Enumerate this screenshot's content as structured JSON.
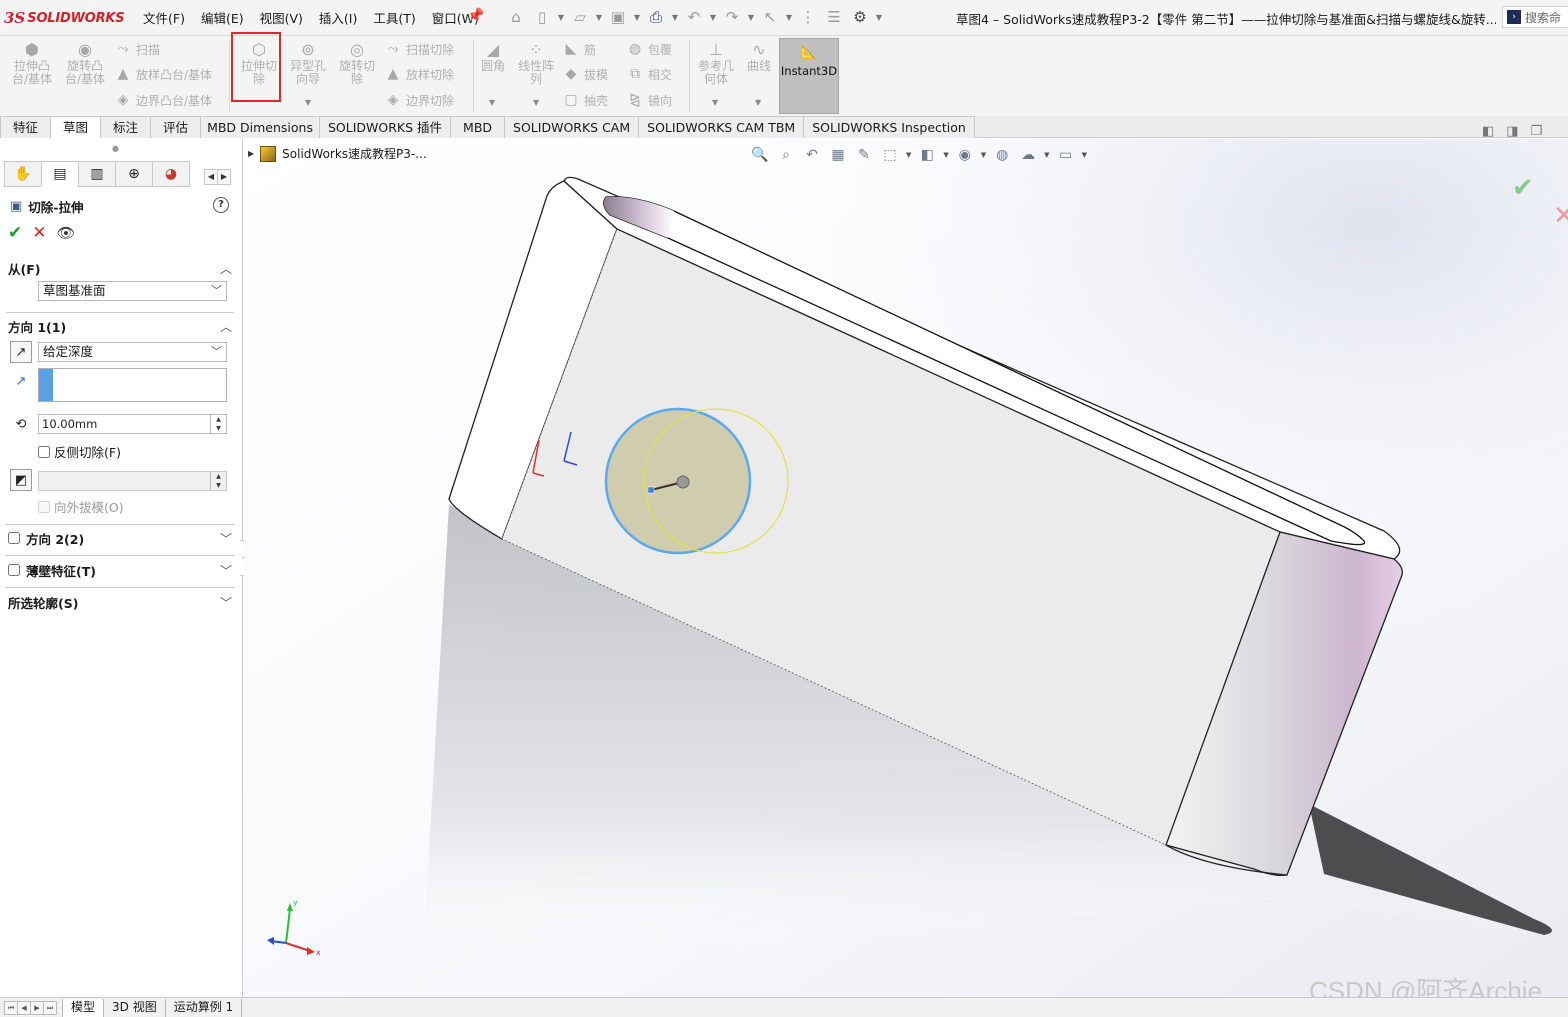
{
  "app": {
    "brand": "SOLIDWORKS",
    "window_title": "草图4 – SolidWorks速成教程P3-2【零件 第二节】——拉伸切除与基准面&扫描与螺旋线&旋转...",
    "search_placeholder": "搜索命"
  },
  "menu": [
    "文件(F)",
    "编辑(E)",
    "视图(V)",
    "插入(I)",
    "工具(T)",
    "窗口(W)"
  ],
  "quick_access": [
    "home-icon",
    "new-file-icon",
    "open-folder-icon",
    "save-icon",
    "print-icon",
    "undo-icon",
    "redo-icon",
    "select-arrow-icon",
    "traffic-light-icon",
    "file-properties-icon",
    "options-gear-icon"
  ],
  "command_manager": {
    "extrude_boss": "拉伸凸\n台/基体",
    "revolve_boss": "旋转凸\n台/基体",
    "sweep": "扫描",
    "loft": "放样凸台/基体",
    "boundary_boss": "边界凸台/基体",
    "extrude_cut": "拉伸切\n除",
    "hole_wizard": "异型孔\n向导",
    "revolve_cut": "旋转切\n除",
    "sweep_cut": "扫描切除",
    "loft_cut": "放样切除",
    "boundary_cut": "边界切除",
    "fillet": "圆角",
    "linear_pattern": "线性阵\n列",
    "rib": "筋",
    "draft": "拔模",
    "shell": "抽壳",
    "wrap": "包覆",
    "intersect": "相交",
    "mirror": "镜向",
    "ref_geometry": "参考几\n何体",
    "curves": "曲线",
    "instant3d": "Instant3D",
    "highlighted_command": "extrude_cut"
  },
  "tabs": {
    "items": [
      "特征",
      "草图",
      "标注",
      "评估",
      "MBD Dimensions",
      "SOLIDWORKS 插件",
      "MBD",
      "SOLIDWORKS CAM",
      "SOLIDWORKS CAM TBM",
      "SOLIDWORKS Inspection"
    ],
    "active": "特征"
  },
  "property_manager": {
    "title": "切除-拉伸",
    "from_section": {
      "label": "从(F)",
      "value": "草图基准面"
    },
    "direction1": {
      "label": "方向 1(1)",
      "end_condition": "给定深度",
      "depth": "10.00mm",
      "flip_side_label": "反侧切除(F)",
      "flip_side_checked": false,
      "draft_outward_label": "向外拔模(O)",
      "draft_outward_checked": false
    },
    "direction2": {
      "label": "方向 2(2)",
      "checked": false
    },
    "thin_feature": {
      "label": "薄壁特征(T)",
      "checked": false
    },
    "selected_contours": {
      "label": "所选轮廓(S)"
    }
  },
  "viewport": {
    "tree_flyout_label": "SolidWorks速成教程P3-...",
    "triad_axes": [
      "y",
      "x"
    ],
    "watermark": "CSDN @阿齐Archie"
  },
  "bottom_tabs": {
    "items": [
      "模型",
      "3D 视图",
      "运动算例 1"
    ],
    "active": "模型"
  },
  "colors": {
    "accent_red": "#e5262a",
    "brand_red": "#d4202a",
    "ok_green": "#1f9a2e",
    "cancel_red": "#d8272e",
    "instant3d_bg": "#bfbfbf",
    "selection_blue": "#5aa0e6",
    "sketch_circle_blue": "#5aa9f0",
    "preview_circle_yellow": "#e2e24a"
  }
}
